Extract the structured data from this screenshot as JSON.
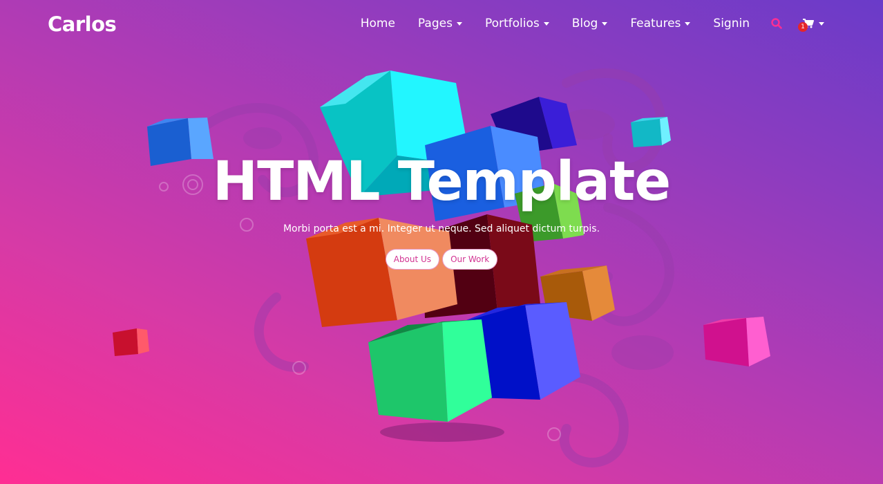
{
  "brand": {
    "name": "Carlos"
  },
  "nav": {
    "items": [
      {
        "label": "Home",
        "dropdown": false
      },
      {
        "label": "Pages",
        "dropdown": true
      },
      {
        "label": "Portfolios",
        "dropdown": true
      },
      {
        "label": "Blog",
        "dropdown": true
      },
      {
        "label": "Features",
        "dropdown": true
      },
      {
        "label": "Signin",
        "dropdown": false
      }
    ],
    "search_icon": "search-icon",
    "cart_icon": "cart-icon",
    "cart_count": "1"
  },
  "hero": {
    "title": "HTML Template",
    "subtitle": "Morbi porta est a mi. Integer ut neque. Sed aliquet dictum turpis.",
    "buttons": {
      "about": "About Us",
      "work": "Our Work"
    }
  },
  "colors": {
    "accent": "#ff2e93",
    "search": "#ff2e93",
    "badge": "#e5252a",
    "button_text": "#d23392"
  }
}
